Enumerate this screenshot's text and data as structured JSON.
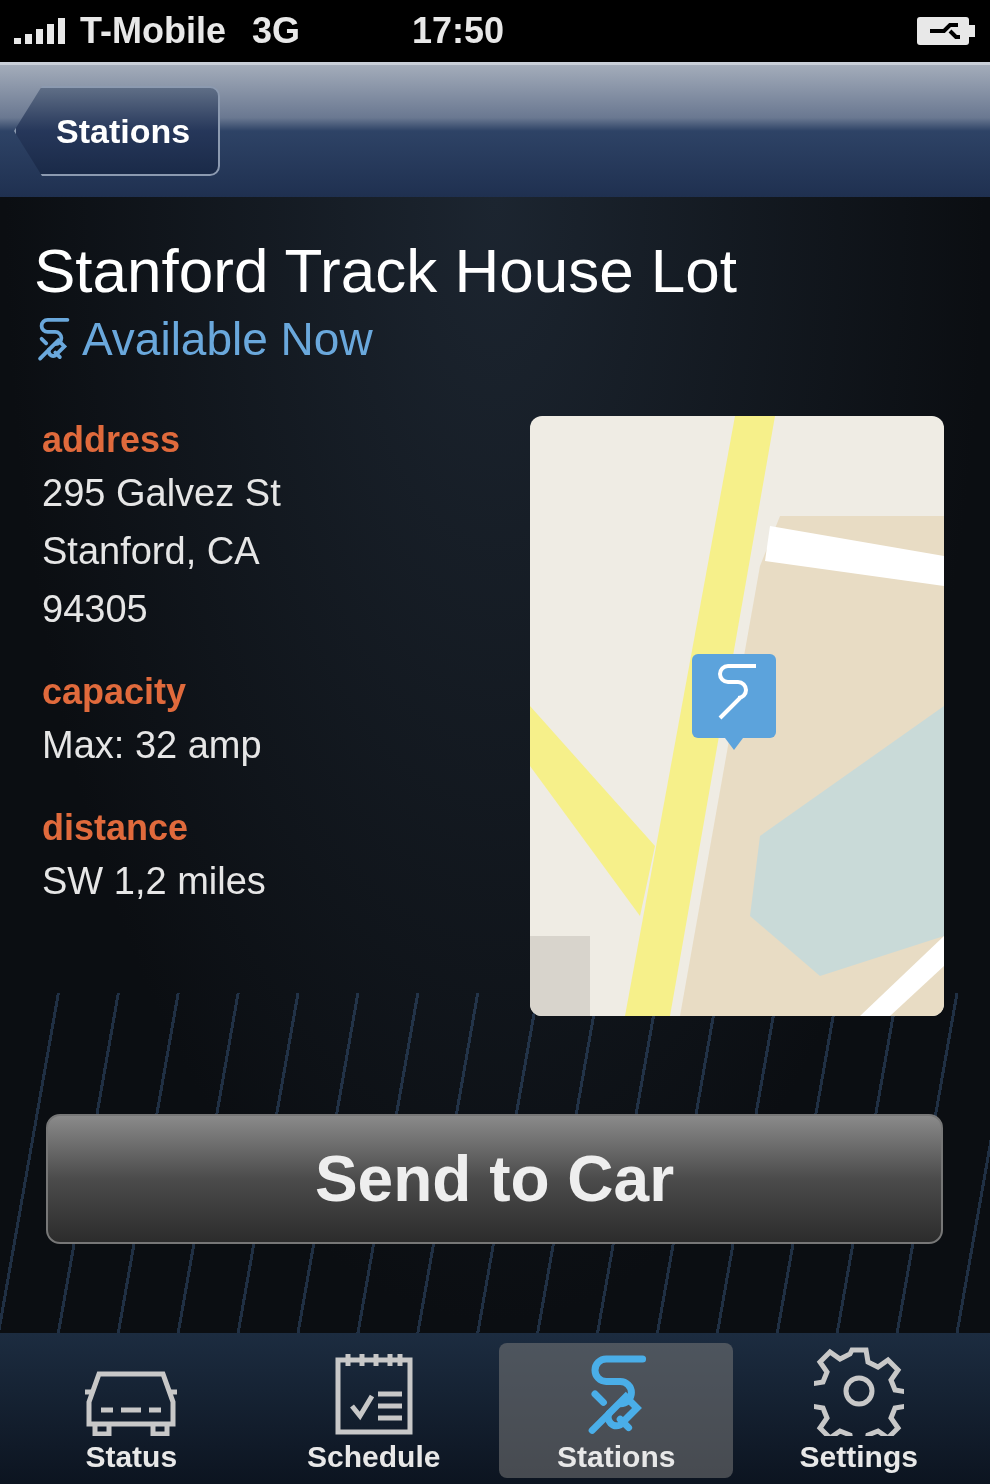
{
  "status_bar": {
    "carrier": "T-Mobile",
    "network": "3G",
    "time": "17:50"
  },
  "nav_bar": {
    "back_button": "Stations"
  },
  "station": {
    "name": "Stanford Track House Lot",
    "availability": "Available Now"
  },
  "details": [
    {
      "label": "address",
      "lines": [
        "295 Galvez St",
        "Stanford, CA",
        "94305"
      ]
    },
    {
      "label": "capacity",
      "lines": [
        "Max: 32 amp"
      ]
    },
    {
      "label": "distance",
      "lines": [
        "SW 1,2 miles"
      ]
    }
  ],
  "send_button": "Send to Car",
  "tab_bar": [
    {
      "label": "Status",
      "kind": "car",
      "selected": false
    },
    {
      "label": "Schedule",
      "kind": "schedule",
      "selected": false
    },
    {
      "label": "Stations",
      "kind": "plug",
      "selected": true
    },
    {
      "label": "Settings",
      "kind": "gear",
      "selected": false
    }
  ]
}
